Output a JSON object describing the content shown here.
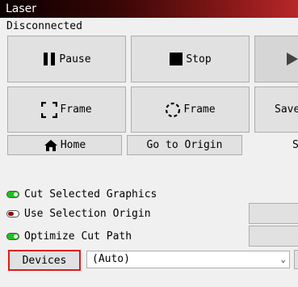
{
  "window": {
    "title": "Laser"
  },
  "status": "Disconnected",
  "buttons": {
    "pause": "Pause",
    "stop": "Stop",
    "frame_rect": "Frame",
    "frame_circle": "Frame",
    "save_partial": "Save",
    "home": "Home",
    "go_to_origin": "Go to Origin",
    "partial_right_label": "S"
  },
  "options": [
    {
      "label": "Cut Selected Graphics",
      "state": "on"
    },
    {
      "label": "Use Selection Origin",
      "state": "off"
    },
    {
      "label": "Optimize Cut Path",
      "state": "on"
    }
  ],
  "devices": {
    "button_label": "Devices",
    "selected": "(Auto)"
  },
  "colors": {
    "title_gradient_start": "#0a0000",
    "title_gradient_end": "#b8282a",
    "toggle_on": "#1fbf1f",
    "toggle_off_knob": "#8a0d0d",
    "highlight": "#e0191b"
  }
}
